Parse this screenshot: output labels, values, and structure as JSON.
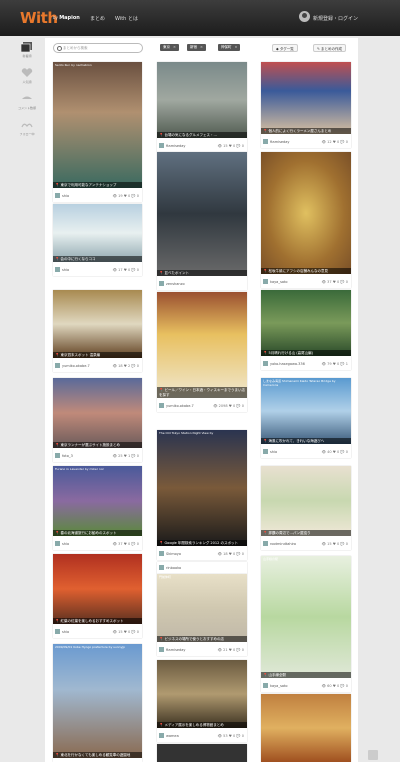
{
  "header": {
    "logo": "With",
    "logo_by": "by",
    "logo_brand": "Mapion",
    "nav": [
      "まとめ",
      "With とは"
    ],
    "user_label": "新規登録・ログイン"
  },
  "sidebar": {
    "items": [
      {
        "label": "新着順",
        "icon": "grid-icon"
      },
      {
        "label": "人気順",
        "icon": "heart-icon"
      },
      {
        "label": "コメント数順",
        "icon": "comment-icon"
      },
      {
        "label": "フォロー中",
        "icon": "follow-icon"
      }
    ]
  },
  "toolbar": {
    "search_placeholder": "まとめから検索",
    "tags": [
      "東京",
      "新宿",
      "神保町"
    ],
    "tag_list_label": "タグ一覧",
    "create_label": "まとめの作成"
  },
  "cards": [
    {
      "caption": "東京で利用可能なアンテナショップ",
      "overlay": "Sento Kun by nachabron",
      "user": "shio",
      "views": "19",
      "likes": "0",
      "comments": "0"
    },
    {
      "caption": "台場の気になるグルメフェス・…",
      "overlay": "",
      "user": "ftamiseday",
      "views": "15",
      "likes": "0",
      "comments": "0"
    },
    {
      "caption": "個人的によく行くラーメン屋さんまとめ",
      "overlay": "",
      "user": "ftamiseday",
      "views": "12",
      "likes": "0",
      "comments": "0"
    },
    {
      "caption": "会の中に行くならココ",
      "overlay": "",
      "user": "shio",
      "views": "17",
      "likes": "0",
      "comments": "0"
    },
    {
      "caption": "並べたポイント",
      "overlay": "",
      "user": "zenshanzo",
      "views": "",
      "likes": "",
      "comments": ""
    },
    {
      "caption": "松坂牛焼にアフシの店舗みんなの意見",
      "overlay": "",
      "user": "kaya_sato",
      "views": "37",
      "likes": "0",
      "comments": "0"
    },
    {
      "caption": "東京週末スポット 温泉編",
      "overlay": "",
      "user": "yumiko.okabe.7",
      "views": "18",
      "likes": "2",
      "comments": "0"
    },
    {
      "caption": "ビール／ワイン・日本酒・ウィスキーまでうまい店を探す",
      "overlay": "",
      "user": "yumiko.okabe.7",
      "views": "2098",
      "likes": "0",
      "comments": "0"
    },
    {
      "caption": "5月晴れ行ける山 (高尾山編)",
      "overlay": "",
      "user": "yoko.hasegawa.336",
      "views": "79",
      "likes": "0",
      "comments": "1"
    },
    {
      "caption": "東京ランナーが選ぶサイト施設まとめ",
      "overlay": "",
      "user": "foto_3",
      "views": "25",
      "likes": "1",
      "comments": "0"
    },
    {
      "caption": "Google 年間検索ランキング 2012 のスポット",
      "overlay": "The Old Tokyo Station Night View by",
      "user": "Skimoyo",
      "views": "18",
      "likes": "0",
      "comments": "0"
    },
    {
      "caption": "海風に吹かれて、きれいな海遊びへ",
      "overlay": "しまなみ海道 Shimanami Kaido Tatarao Bridge by Camerons",
      "user": "shio",
      "views": "40",
      "likes": "0",
      "comments": "0"
    },
    {
      "caption": "春の北海道旅行にお勧めのスポット",
      "overlay": "Furano in Lavender by miker nor",
      "user": "shio",
      "views": "37",
      "likes": "0",
      "comments": "0"
    },
    {
      "caption": "",
      "overlay": "",
      "user": "rinbooko",
      "views": "",
      "likes": "",
      "comments": ""
    },
    {
      "caption": "那覇の周辺で…パン屋巡り",
      "overlay": "",
      "user": "rootmindtahiro",
      "views": "15",
      "likes": "0",
      "comments": "0"
    },
    {
      "caption": "紅葉の紅葉を楽しめるおすすめスポット",
      "overlay": "",
      "user": "shio",
      "views": "15",
      "likes": "0",
      "comments": "0"
    },
    {
      "caption": "ビジネスの場所で使うとおすすめの店",
      "overlay": "門前仲町",
      "user": "ftamiseday",
      "views": "21",
      "likes": "0",
      "comments": "0"
    },
    {
      "caption": "山手線全駅",
      "overlay": "山手線の駅",
      "user": "kaya_sato",
      "views": "60",
      "likes": "0",
      "comments": "0"
    },
    {
      "caption": "東北を行かなくても楽しめる観覧車の遊園地",
      "overlay": "2009/09/01 Kobe Hyogo prefecture by sunnyjp",
      "user": "",
      "views": "",
      "likes": "",
      "comments": ""
    },
    {
      "caption": "メディア展示を楽しめる博物館まとめ",
      "overlay": "",
      "user": "wamea",
      "views": "53",
      "likes": "0",
      "comments": "0"
    },
    {
      "caption": "",
      "overlay": "",
      "user": "",
      "views": "",
      "likes": "",
      "comments": ""
    },
    {
      "caption": "",
      "overlay": "",
      "user": "",
      "views": "",
      "likes": "",
      "comments": ""
    }
  ],
  "colors": {
    "logo": "#e8782c",
    "header_bg": "#2a2a2a",
    "page_bg": "#e9e9e9"
  }
}
